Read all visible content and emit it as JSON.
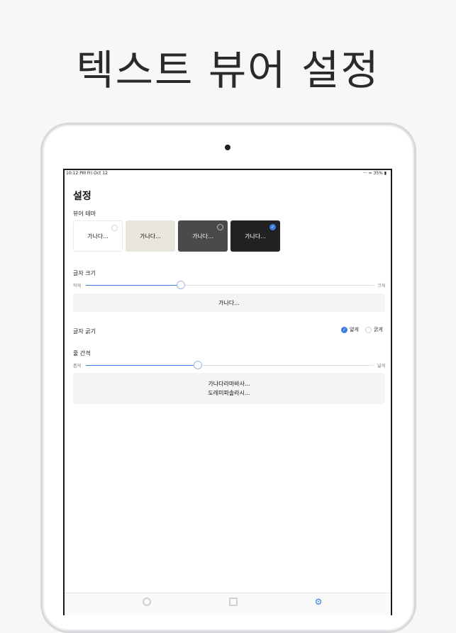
{
  "headline": "텍스트 뷰어 설정",
  "status": {
    "time": "10:12 PM   Fri Oct 12",
    "right": "··· ≈ 35% ▮"
  },
  "settings": {
    "title": "설정",
    "theme_label": "뷰어 테마",
    "themes": [
      {
        "label": "가나다...",
        "bg": "#ffffff",
        "fg": "#222222",
        "selected": false
      },
      {
        "label": "가나다...",
        "bg": "#e9e6dc",
        "fg": "#111111",
        "selected": false
      },
      {
        "label": "가나다...",
        "bg": "#4a4a4a",
        "fg": "#ffffff",
        "selected": false
      },
      {
        "label": "가나다...",
        "bg": "#222222",
        "fg": "#ffffff",
        "selected": true
      }
    ],
    "font_size": {
      "label": "글자 크기",
      "min_label": "작게",
      "max_label": "크게",
      "value": 0.33,
      "preview": "가나다..."
    },
    "font_weight": {
      "label": "글자 굵기",
      "options": [
        {
          "label": "얇게",
          "selected": true
        },
        {
          "label": "굵게",
          "selected": false
        }
      ]
    },
    "line_spacing": {
      "label": "줄 간격",
      "min_label": "좁게",
      "max_label": "넓게",
      "value": 0.39,
      "preview_lines": [
        "가나다라마바사...",
        "도레미파솔라시..."
      ]
    }
  },
  "tabs": [
    {
      "icon": "clock-icon"
    },
    {
      "icon": "document-icon"
    },
    {
      "icon": "gear-icon",
      "active": true
    }
  ],
  "accent": "#3d7be0"
}
